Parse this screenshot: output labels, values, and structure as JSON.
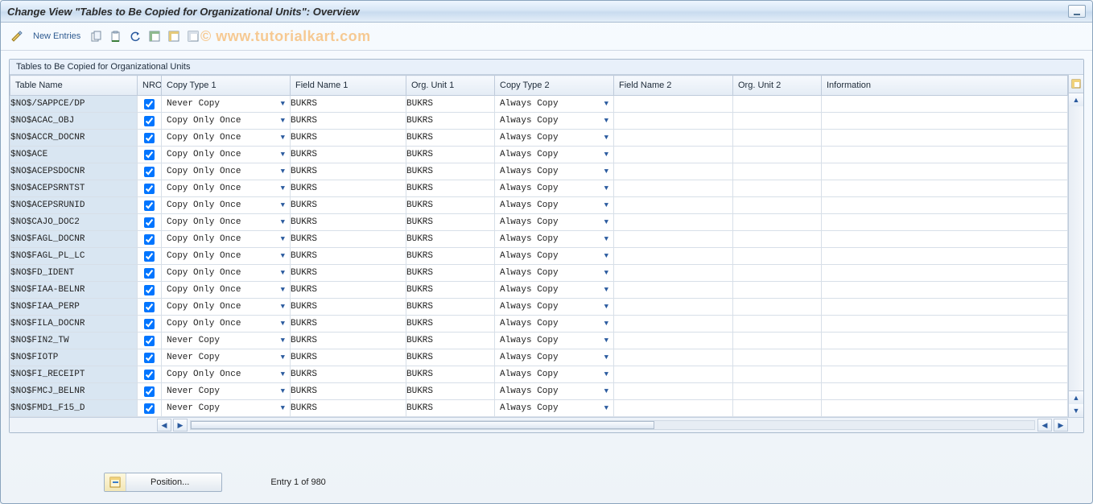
{
  "window_title": "Change View \"Tables to Be Copied for Organizational Units\": Overview",
  "watermark": "© www.tutorialkart.com",
  "toolbar": {
    "new_entries": "New Entries"
  },
  "panel_title": "Tables to Be Copied for Organizational Units",
  "columns": {
    "table_name": "Table Name",
    "nro": "NRO",
    "copy_type_1": "Copy Type 1",
    "field_name_1": "Field Name 1",
    "org_unit_1": "Org. Unit 1",
    "copy_type_2": "Copy Type 2",
    "field_name_2": "Field Name 2",
    "org_unit_2": "Org. Unit 2",
    "information": "Information"
  },
  "rows": [
    {
      "table_name": "$NO$/SAPPCE/DP",
      "nro": true,
      "copy_type_1": "Never Copy",
      "field_name_1": "BUKRS",
      "org_unit_1": "BUKRS",
      "copy_type_2": "Always Copy",
      "field_name_2": "",
      "org_unit_2": "",
      "information": ""
    },
    {
      "table_name": "$NO$ACAC_OBJ",
      "nro": true,
      "copy_type_1": "Copy Only Once",
      "field_name_1": "BUKRS",
      "org_unit_1": "BUKRS",
      "copy_type_2": "Always Copy",
      "field_name_2": "",
      "org_unit_2": "",
      "information": ""
    },
    {
      "table_name": "$NO$ACCR_DOCNR",
      "nro": true,
      "copy_type_1": "Copy Only Once",
      "field_name_1": "BUKRS",
      "org_unit_1": "BUKRS",
      "copy_type_2": "Always Copy",
      "field_name_2": "",
      "org_unit_2": "",
      "information": ""
    },
    {
      "table_name": "$NO$ACE",
      "nro": true,
      "copy_type_1": "Copy Only Once",
      "field_name_1": "BUKRS",
      "org_unit_1": "BUKRS",
      "copy_type_2": "Always Copy",
      "field_name_2": "",
      "org_unit_2": "",
      "information": ""
    },
    {
      "table_name": "$NO$ACEPSDOCNR",
      "nro": true,
      "copy_type_1": "Copy Only Once",
      "field_name_1": "BUKRS",
      "org_unit_1": "BUKRS",
      "copy_type_2": "Always Copy",
      "field_name_2": "",
      "org_unit_2": "",
      "information": ""
    },
    {
      "table_name": "$NO$ACEPSRNTST",
      "nro": true,
      "copy_type_1": "Copy Only Once",
      "field_name_1": "BUKRS",
      "org_unit_1": "BUKRS",
      "copy_type_2": "Always Copy",
      "field_name_2": "",
      "org_unit_2": "",
      "information": ""
    },
    {
      "table_name": "$NO$ACEPSRUNID",
      "nro": true,
      "copy_type_1": "Copy Only Once",
      "field_name_1": "BUKRS",
      "org_unit_1": "BUKRS",
      "copy_type_2": "Always Copy",
      "field_name_2": "",
      "org_unit_2": "",
      "information": ""
    },
    {
      "table_name": "$NO$CAJO_DOC2",
      "nro": true,
      "copy_type_1": "Copy Only Once",
      "field_name_1": "BUKRS",
      "org_unit_1": "BUKRS",
      "copy_type_2": "Always Copy",
      "field_name_2": "",
      "org_unit_2": "",
      "information": ""
    },
    {
      "table_name": "$NO$FAGL_DOCNR",
      "nro": true,
      "copy_type_1": "Copy Only Once",
      "field_name_1": "BUKRS",
      "org_unit_1": "BUKRS",
      "copy_type_2": "Always Copy",
      "field_name_2": "",
      "org_unit_2": "",
      "information": ""
    },
    {
      "table_name": "$NO$FAGL_PL_LC",
      "nro": true,
      "copy_type_1": "Copy Only Once",
      "field_name_1": "BUKRS",
      "org_unit_1": "BUKRS",
      "copy_type_2": "Always Copy",
      "field_name_2": "",
      "org_unit_2": "",
      "information": ""
    },
    {
      "table_name": "$NO$FD_IDENT",
      "nro": true,
      "copy_type_1": "Copy Only Once",
      "field_name_1": "BUKRS",
      "org_unit_1": "BUKRS",
      "copy_type_2": "Always Copy",
      "field_name_2": "",
      "org_unit_2": "",
      "information": ""
    },
    {
      "table_name": "$NO$FIAA-BELNR",
      "nro": true,
      "copy_type_1": "Copy Only Once",
      "field_name_1": "BUKRS",
      "org_unit_1": "BUKRS",
      "copy_type_2": "Always Copy",
      "field_name_2": "",
      "org_unit_2": "",
      "information": ""
    },
    {
      "table_name": "$NO$FIAA_PERP",
      "nro": true,
      "copy_type_1": "Copy Only Once",
      "field_name_1": "BUKRS",
      "org_unit_1": "BUKRS",
      "copy_type_2": "Always Copy",
      "field_name_2": "",
      "org_unit_2": "",
      "information": ""
    },
    {
      "table_name": "$NO$FILA_DOCNR",
      "nro": true,
      "copy_type_1": "Copy Only Once",
      "field_name_1": "BUKRS",
      "org_unit_1": "BUKRS",
      "copy_type_2": "Always Copy",
      "field_name_2": "",
      "org_unit_2": "",
      "information": ""
    },
    {
      "table_name": "$NO$FIN2_TW",
      "nro": true,
      "copy_type_1": "Never Copy",
      "field_name_1": "BUKRS",
      "org_unit_1": "BUKRS",
      "copy_type_2": "Always Copy",
      "field_name_2": "",
      "org_unit_2": "",
      "information": ""
    },
    {
      "table_name": "$NO$FIOTP",
      "nro": true,
      "copy_type_1": "Never Copy",
      "field_name_1": "BUKRS",
      "org_unit_1": "BUKRS",
      "copy_type_2": "Always Copy",
      "field_name_2": "",
      "org_unit_2": "",
      "information": ""
    },
    {
      "table_name": "$NO$FI_RECEIPT",
      "nro": true,
      "copy_type_1": "Copy Only Once",
      "field_name_1": "BUKRS",
      "org_unit_1": "BUKRS",
      "copy_type_2": "Always Copy",
      "field_name_2": "",
      "org_unit_2": "",
      "information": ""
    },
    {
      "table_name": "$NO$FMCJ_BELNR",
      "nro": true,
      "copy_type_1": "Never Copy",
      "field_name_1": "BUKRS",
      "org_unit_1": "BUKRS",
      "copy_type_2": "Always Copy",
      "field_name_2": "",
      "org_unit_2": "",
      "information": ""
    },
    {
      "table_name": "$NO$FMD1_F15_D",
      "nro": true,
      "copy_type_1": "Never Copy",
      "field_name_1": "BUKRS",
      "org_unit_1": "BUKRS",
      "copy_type_2": "Always Copy",
      "field_name_2": "",
      "org_unit_2": "",
      "information": ""
    }
  ],
  "footer": {
    "position_btn": "Position...",
    "entry_text": "Entry 1 of 980"
  }
}
